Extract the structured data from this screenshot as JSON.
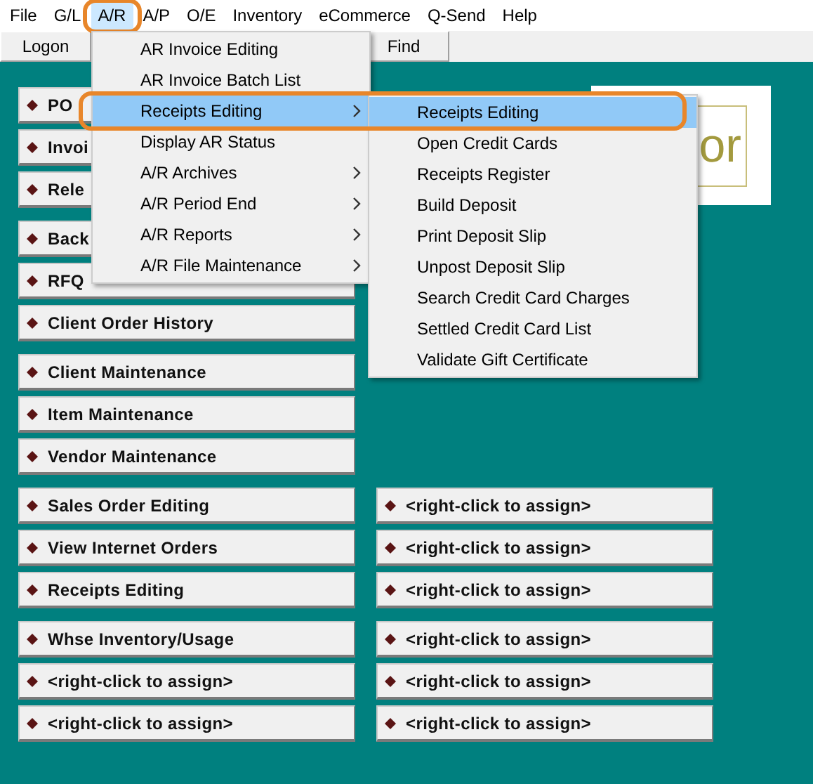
{
  "menu_bar": [
    {
      "label": "File",
      "selected": false,
      "circled": false
    },
    {
      "label": "G/L",
      "selected": false,
      "circled": false
    },
    {
      "label": "A/R",
      "selected": true,
      "circled": true
    },
    {
      "label": "A/P",
      "selected": false,
      "circled": false
    },
    {
      "label": "O/E",
      "selected": false,
      "circled": false
    },
    {
      "label": "Inventory",
      "selected": false,
      "circled": false
    },
    {
      "label": "eCommerce",
      "selected": false,
      "circled": false
    },
    {
      "label": "Q-Send",
      "selected": false,
      "circled": false
    },
    {
      "label": "Help",
      "selected": false,
      "circled": false
    }
  ],
  "toolbar": [
    {
      "label": "Logon"
    },
    {
      "label": "Find"
    }
  ],
  "dropdown": {
    "items": [
      {
        "label": "AR Invoice Editing",
        "selected": false,
        "submenu": false,
        "circled": false
      },
      {
        "label": "AR Invoice Batch List",
        "selected": false,
        "submenu": false,
        "circled": false
      },
      {
        "label": "Receipts Editing",
        "selected": true,
        "submenu": true,
        "circled": true
      },
      {
        "label": "Display AR Status",
        "selected": false,
        "submenu": false,
        "circled": false
      },
      {
        "label": "A/R Archives",
        "selected": false,
        "submenu": true,
        "circled": false
      },
      {
        "label": "A/R Period End",
        "selected": false,
        "submenu": true,
        "circled": false
      },
      {
        "label": "A/R Reports",
        "selected": false,
        "submenu": true,
        "circled": false
      },
      {
        "label": "A/R File Maintenance",
        "selected": false,
        "submenu": true,
        "circled": false
      }
    ]
  },
  "submenu": {
    "items": [
      {
        "label": "Receipts Editing",
        "selected": true
      },
      {
        "label": "Open Credit Cards",
        "selected": false
      },
      {
        "label": "Receipts Register",
        "selected": false
      },
      {
        "label": "Build Deposit",
        "selected": false
      },
      {
        "label": "Print Deposit Slip",
        "selected": false
      },
      {
        "label": "Unpost Deposit Slip",
        "selected": false
      },
      {
        "label": "Search Credit Card Charges",
        "selected": false
      },
      {
        "label": "Settled Credit Card List",
        "selected": false
      },
      {
        "label": "Validate Gift Certificate",
        "selected": false
      }
    ]
  },
  "logo": {
    "text": "or"
  },
  "top_groups": [
    {
      "buttons": [
        "PO",
        "Invoi",
        "Rele"
      ]
    },
    {
      "buttons": [
        "Back",
        "RFQ",
        "Client Order History"
      ]
    },
    {
      "buttons": [
        "Client Maintenance",
        "Item Maintenance",
        "Vendor Maintenance"
      ]
    }
  ],
  "bottom_groups": [
    {
      "rows": [
        {
          "left": "Sales Order Editing",
          "right": "<right-click to assign>"
        },
        {
          "left": "View Internet Orders",
          "right": "<right-click to assign>"
        },
        {
          "left": "Receipts Editing",
          "right": "<right-click to assign>"
        }
      ]
    },
    {
      "rows": [
        {
          "left": "Whse Inventory/Usage",
          "right": "<right-click to assign>"
        },
        {
          "left": "<right-click to assign>",
          "right": "<right-click to assign>"
        },
        {
          "left": "<right-click to assign>",
          "right": "<right-click to assign>"
        }
      ]
    }
  ]
}
